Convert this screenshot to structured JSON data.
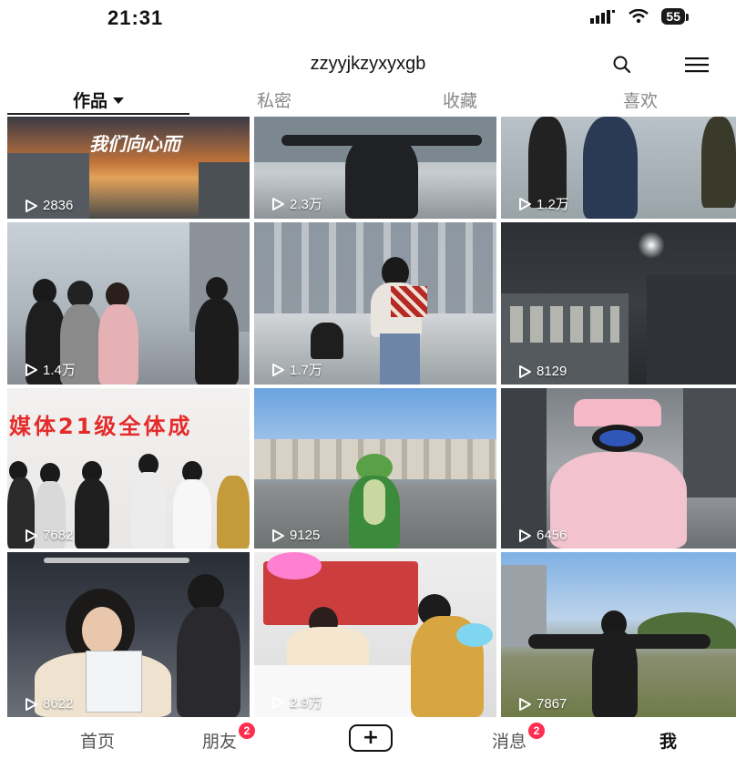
{
  "status_bar": {
    "time": "21:31",
    "battery": "55"
  },
  "header": {
    "username": "zzyyjkzyxyxgb"
  },
  "tabs": [
    {
      "label": "作品",
      "active": true
    },
    {
      "label": "私密",
      "active": false
    },
    {
      "label": "收藏",
      "active": false
    },
    {
      "label": "喜欢",
      "active": false
    }
  ],
  "videos": [
    {
      "views": "2836",
      "overlay": "我们向心而"
    },
    {
      "views": "2.3万"
    },
    {
      "views": "1.2万"
    },
    {
      "views": "1.4万"
    },
    {
      "views": "1.7万"
    },
    {
      "views": "8129"
    },
    {
      "views": "7682",
      "overlay": "媒体21级全体成"
    },
    {
      "views": "9125"
    },
    {
      "views": "6456"
    },
    {
      "views": "8622"
    },
    {
      "views": "2.9万"
    },
    {
      "views": "7867"
    }
  ],
  "bottom_nav": {
    "home": "首页",
    "friends": "朋友",
    "friends_badge": "2",
    "create": "+",
    "messages": "消息",
    "messages_badge": "2",
    "me": "我"
  },
  "colors": {
    "badge": "#ff2d4f",
    "accent_text": "#111111"
  }
}
